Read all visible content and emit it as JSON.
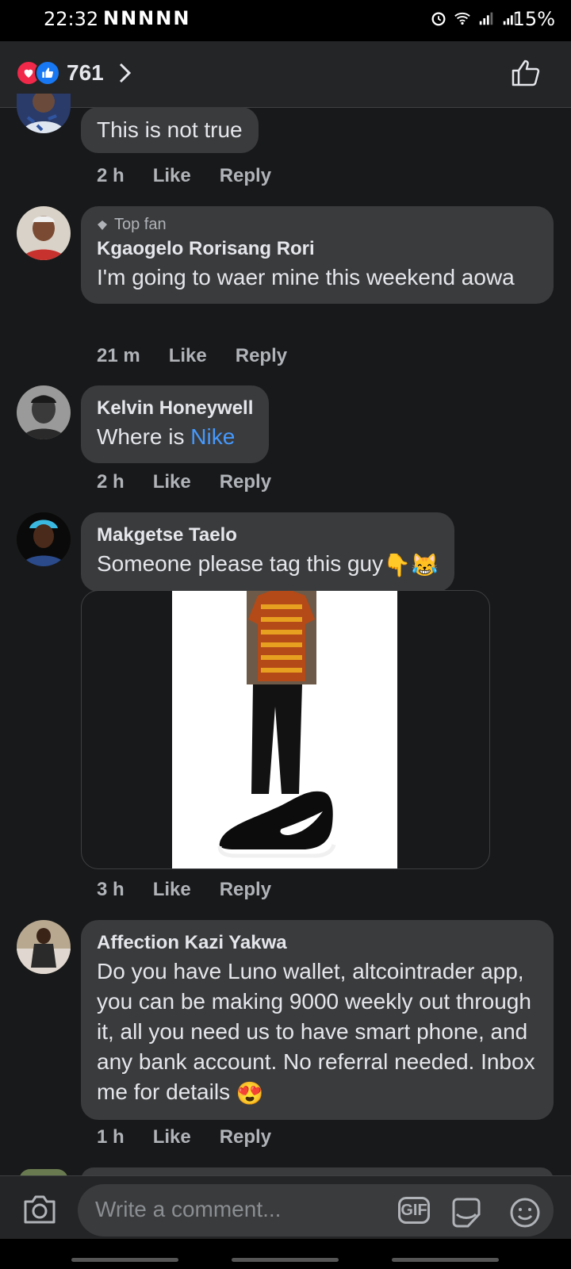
{
  "status_bar": {
    "time": "22:32",
    "notification_icons": "NNNNN",
    "battery": "15%"
  },
  "header": {
    "reaction_count": "761"
  },
  "comments": [
    {
      "name": "",
      "text": "This is not true",
      "time": "2 h",
      "like": "Like",
      "reply": "Reply"
    },
    {
      "badge": "Top fan",
      "name": "Kgaogelo Rorisang Rori",
      "text": "I'm going to waer mine this weekend aowa",
      "time": "21 m",
      "like": "Like",
      "reply": "Reply"
    },
    {
      "name": "Kelvin Honeywell",
      "text": "Where is ",
      "mention": "Nike",
      "time": "2 h",
      "like": "Like",
      "reply": "Reply"
    },
    {
      "name": "Makgetse Taelo",
      "text": "Someone please tag this guy",
      "emojis": "👇😹",
      "time": "3 h",
      "like": "Like",
      "reply": "Reply"
    },
    {
      "name": "Affection Kazi Yakwa",
      "text": "Do you have Luno wallet, altcointrader app, you can be making 9000 weekly out through it, all you need us to have smart phone, and any bank account. No referral needed. Inbox me for details",
      "emojis": "😍",
      "time": "1 h",
      "like": "Like",
      "reply": "Reply"
    }
  ],
  "composer": {
    "placeholder": "Write a comment...",
    "gif_label": "GIF"
  },
  "colors": {
    "background": "#18191a",
    "bubble": "#3a3b3c",
    "mention": "#4599ff",
    "love": "#f0284a",
    "like": "#1877f2"
  }
}
